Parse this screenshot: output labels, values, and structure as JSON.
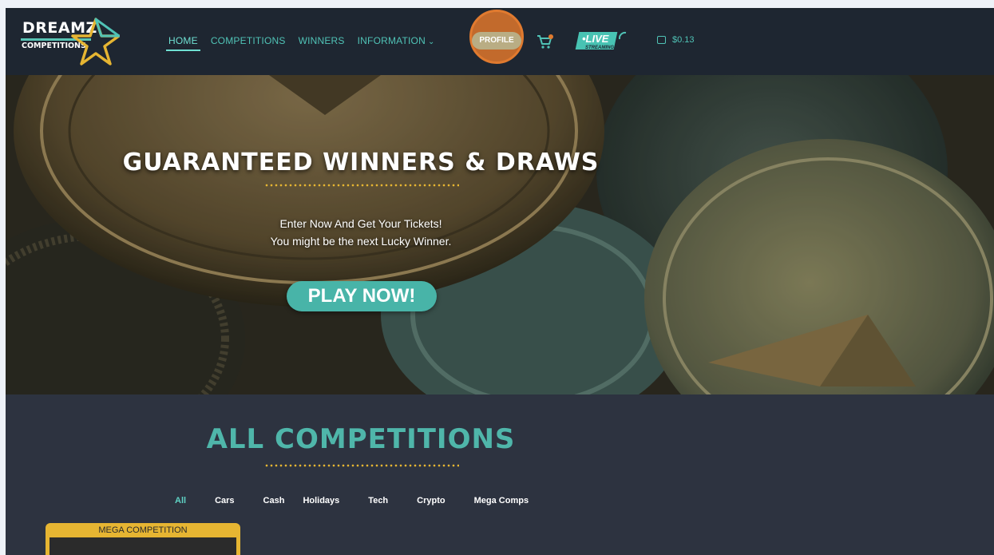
{
  "brand": {
    "logo_line1": "DREAMZ",
    "logo_line2": "COMPETITIONS",
    "accent": "#50c3b6",
    "gold": "#e6b532"
  },
  "nav": {
    "items": [
      {
        "label": "HOME",
        "active": true
      },
      {
        "label": "COMPETITIONS"
      },
      {
        "label": "WINNERS"
      },
      {
        "label": "INFORMATION",
        "has_dropdown": true
      }
    ],
    "profile_label": "PROFILE",
    "cart_icon": "shopping-cart-icon",
    "live_label": "•LIVE",
    "live_sub": "STREAMING",
    "wallet_amount": "$0.13"
  },
  "hero": {
    "title": "GUARANTEED WINNERS & DRAWS",
    "subtitle_line1": "Enter Now And Get Your Tickets!",
    "subtitle_line2": "You might be the next Lucky Winner.",
    "cta_label": "PLAY NOW!"
  },
  "competitions": {
    "title": "ALL COMPETITIONS",
    "filters": [
      "All",
      "Cars",
      "Cash",
      "Holidays",
      "Tech",
      "Crypto",
      "Mega Comps"
    ],
    "active_filter": "All",
    "first_card_label": "MEGA COMPETITION"
  }
}
